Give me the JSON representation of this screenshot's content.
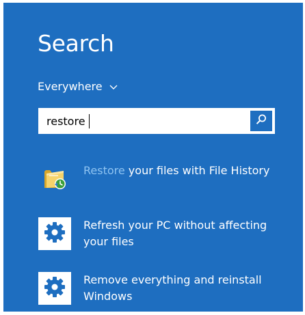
{
  "search": {
    "title": "Search",
    "scope": "Everywhere",
    "query": "restore"
  },
  "results": [
    {
      "highlight": "Restore",
      "rest": " your files with File History",
      "icon": "file-history-folder-icon"
    },
    {
      "text": "Refresh your PC without affecting your files",
      "icon": "gear-icon"
    },
    {
      "text": "Remove everything and reinstall Windows",
      "icon": "gear-icon"
    }
  ],
  "colors": {
    "background": "#1e6ec0",
    "highlight": "#8fc4f2",
    "text": "#ffffff"
  }
}
